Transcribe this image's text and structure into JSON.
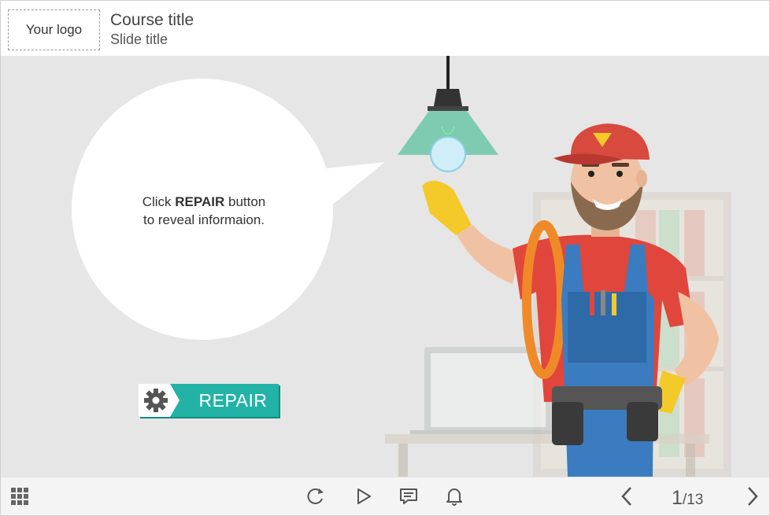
{
  "header": {
    "logo_text": "Your logo",
    "course_title": "Course title",
    "slide_title": "Slide title"
  },
  "slide": {
    "bubble_text_prefix": "Click ",
    "bubble_text_bold": "REPAIR",
    "bubble_text_line1_suffix": " button",
    "bubble_text_line2": "to reveal informaion.",
    "repair_button_label": "REPAIR"
  },
  "footer": {
    "menu_icon": "grid-menu-icon",
    "replay_icon": "replay-icon",
    "play_icon": "play-icon",
    "notes_icon": "notes-icon",
    "notification_icon": "bell-icon",
    "prev_icon": "chevron-left-icon",
    "next_icon": "chevron-right-icon",
    "current_page": "1",
    "total_pages": "/13"
  },
  "colors": {
    "stage_bg": "#e5e6e5",
    "accent_teal": "#22b3a6",
    "shirt_red": "#e0463c",
    "overalls_blue": "#3b7cc0",
    "glove_yellow": "#f4c92a"
  }
}
